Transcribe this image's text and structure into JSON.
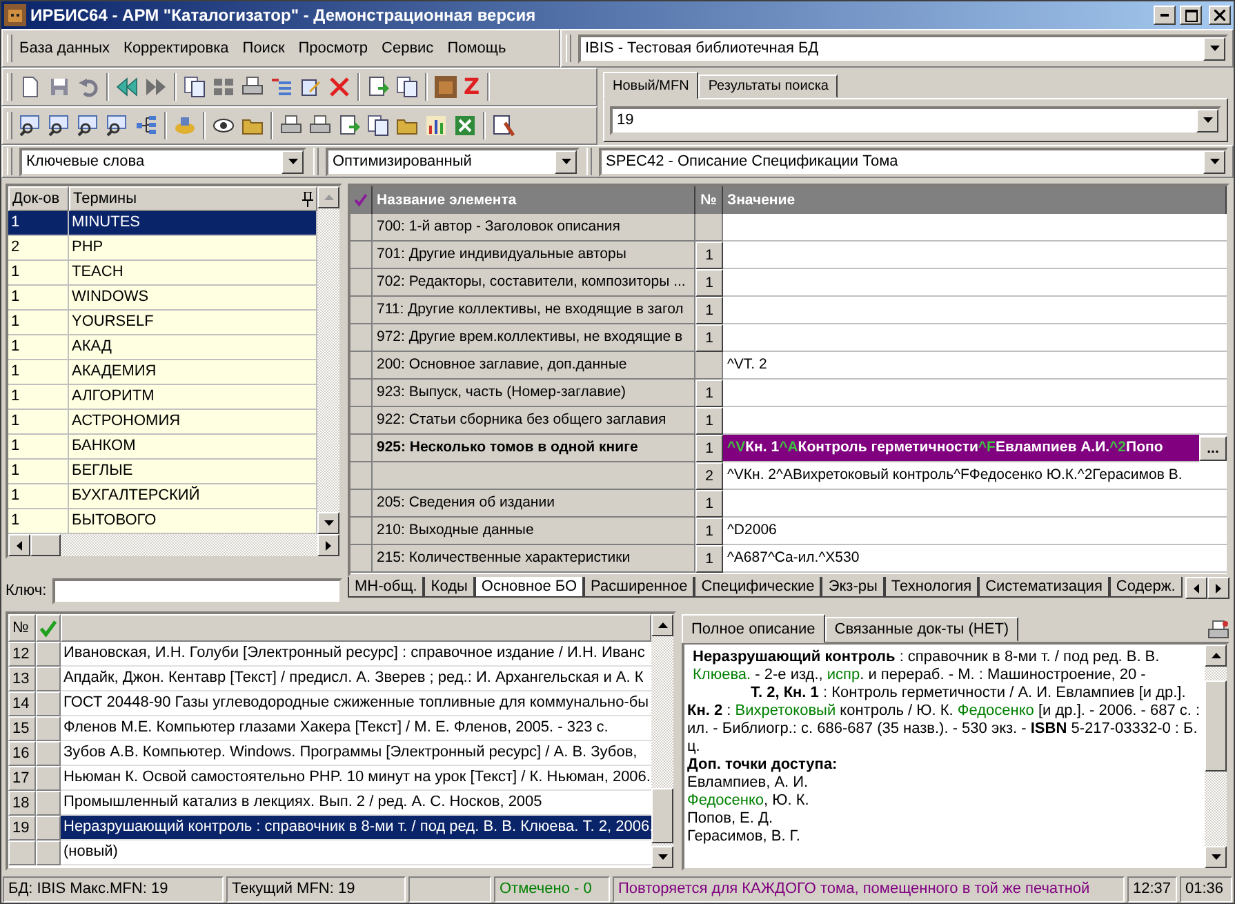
{
  "window": {
    "title": "ИРБИС64 - АРМ \"Каталогизатор\" - Демонстрационная версия"
  },
  "menu": [
    "База данных",
    "Корректировка",
    "Поиск",
    "Просмотр",
    "Сервис",
    "Помощь"
  ],
  "toolbar": {
    "z_button": "Z"
  },
  "database_combo": {
    "value": "IBIS - Тестовая библиотечная БД"
  },
  "search_tabs": [
    {
      "label": "Новый/MFN",
      "selected": true
    },
    {
      "label": "Результаты поиска",
      "selected": false
    }
  ],
  "mfn_combo": {
    "value": "19"
  },
  "dictionary_combo": {
    "value": "Ключевые слова"
  },
  "mode_combo": {
    "value": "Оптимизированный"
  },
  "worksheet_combo": {
    "value": "SPEC42 - Описание Спецификации Тома"
  },
  "terms": {
    "columns": [
      "Док-ов",
      "Термины"
    ],
    "rows": [
      {
        "count": "1",
        "term": "MINUTES",
        "selected": true
      },
      {
        "count": "2",
        "term": "PHP",
        "selected": false
      },
      {
        "count": "1",
        "term": "TEACH",
        "selected": false
      },
      {
        "count": "1",
        "term": "WINDOWS",
        "selected": false
      },
      {
        "count": "1",
        "term": "YOURSELF",
        "selected": false
      },
      {
        "count": "1",
        "term": "АКАД",
        "selected": false
      },
      {
        "count": "1",
        "term": "АКАДЕМИЯ",
        "selected": false
      },
      {
        "count": "1",
        "term": "АЛГОРИТМ",
        "selected": false
      },
      {
        "count": "1",
        "term": "АСТРОНОМИЯ",
        "selected": false
      },
      {
        "count": "1",
        "term": "БАНКОМ",
        "selected": false
      },
      {
        "count": "1",
        "term": "БЕГЛЫЕ",
        "selected": false
      },
      {
        "count": "1",
        "term": "БУХГАЛТЕРСКИЙ",
        "selected": false
      },
      {
        "count": "1",
        "term": "БЫТОВОГО",
        "selected": false
      }
    ]
  },
  "key_field": {
    "label": "Ключ:"
  },
  "fields_grid": {
    "columns": [
      "Название элемента",
      "№",
      "Значение"
    ],
    "rows": [
      {
        "name": "700: 1-й автор - Заголовок описания",
        "bold": false,
        "selected": false
      },
      {
        "name": "701: Другие индивидуальные авторы",
        "occurrence": "1",
        "bold": false,
        "selected": false
      },
      {
        "name": "702: Редакторы, составители, композиторы ...",
        "occurrence": "1",
        "bold": false,
        "selected": false
      },
      {
        "name": "711: Другие коллективы, не входящие в загол",
        "occurrence": "1",
        "bold": false,
        "selected": false
      },
      {
        "name": "972: Другие врем.коллективы, не входящие в",
        "occurrence": "1",
        "bold": false,
        "selected": false
      },
      {
        "name": "200: Основное заглавие, доп.данные",
        "value": "^VТ. 2",
        "bold": false,
        "selected": false
      },
      {
        "name": "923: Выпуск, часть (Номер-заглавие)",
        "occurrence": "1",
        "bold": false,
        "selected": false
      },
      {
        "name": "922: Статьи сборника без общего заглавия",
        "occurrence": "1",
        "bold": false,
        "selected": false
      },
      {
        "name": "925: Несколько томов в одной книге",
        "occurrence": "1",
        "bold": true,
        "selected": true,
        "button": "...",
        "value_runs": [
          {
            "kind": "subfield",
            "text": "^V"
          },
          {
            "kind": "text",
            "text": "Кн. 1"
          },
          {
            "kind": "subfield",
            "text": "^A"
          },
          {
            "kind": "text",
            "text": "Контроль герметичности"
          },
          {
            "kind": "subfield",
            "text": "^F"
          },
          {
            "kind": "text",
            "text": "Евлампиев А.И."
          },
          {
            "kind": "subfield",
            "text": "^2"
          },
          {
            "kind": "text",
            "text": "Попо"
          }
        ]
      },
      {
        "occurrence": "2",
        "value": "^VКн. 2^AВихретоковый контроль^FФедосенко Ю.К.^2Герасимов В.",
        "selected": false
      },
      {
        "name": "205: Сведения об издании",
        "occurrence": "1",
        "bold": false,
        "selected": false
      },
      {
        "name": "210: Выходные данные",
        "occurrence": "1",
        "value": "^D2006",
        "bold": false,
        "selected": false
      },
      {
        "name": "215: Количественные характеристики",
        "occurrence": "1",
        "value": "^A687^Cа-ил.^X530",
        "bold": false,
        "selected": false
      }
    ]
  },
  "worksheet_tabs": [
    {
      "label": "МН-общ.",
      "selected": false
    },
    {
      "label": "Коды",
      "selected": false
    },
    {
      "label": "Основное БО",
      "selected": true
    },
    {
      "label": "Расширенное",
      "selected": false
    },
    {
      "label": "Специфические",
      "selected": false
    },
    {
      "label": "Экз-ры",
      "selected": false
    },
    {
      "label": "Технология",
      "selected": false
    },
    {
      "label": "Систематизация",
      "selected": false
    },
    {
      "label": "Содерж.",
      "selected": false
    }
  ],
  "records": {
    "columns": [
      "№"
    ],
    "rows": [
      {
        "num": "12",
        "text": "Ивановская, И.Н. Голуби [Электронный ресурс] : справочное издание / И.Н. Иванс",
        "selected": false
      },
      {
        "num": "13",
        "text": "Апдайк, Джон. Кентавр [Текст] / предисл. А. Зверев ; ред.: И. Архангельская и А. К",
        "selected": false
      },
      {
        "num": "14",
        "text": "ГОСТ 20448-90 Газы углеводородные сжиженные топливные для коммунально-бы",
        "selected": false
      },
      {
        "num": "15",
        "text": "Фленов М.Е. Компьютер глазами Хакера [Текст] / М. Е. Фленов, 2005. - 323 с.",
        "selected": false
      },
      {
        "num": "16",
        "text": "Зубов А.В. Компьютер. Windows. Программы [Электронный ресурс] / А. В. Зубов,",
        "selected": false
      },
      {
        "num": "17",
        "text": "Ньюман К. Освой самостоятельно PHP. 10 минут на урок [Текст] / К. Ньюман, 2006.",
        "selected": false
      },
      {
        "num": "18",
        "text": "Промышленный катализ в лекциях. Вып. 2 / ред. А. С. Носков, 2005",
        "selected": false
      },
      {
        "num": "19",
        "text": "Неразрушающий контроль : справочник в 8-ми т. / под ред. В. В. Клюева. Т. 2, 2006.",
        "selected": true
      },
      {
        "text": "(новый)",
        "selected": false
      }
    ]
  },
  "description_tabs": [
    {
      "label": "Полное описание",
      "selected": true
    },
    {
      "label": "Связанные док-ты (НЕТ)",
      "selected": false
    }
  ],
  "description": {
    "paragraphs": [
      {
        "kind": "body",
        "runs": [
          {
            "kind": "bold",
            "text": "Неразрушающий контроль"
          },
          {
            "kind": "text",
            "text": " : справочник в 8-ми т. / под ред. В. В. "
          },
          {
            "kind": "link",
            "text": "Клюева."
          },
          {
            "kind": "text",
            "text": " - 2-е изд., "
          },
          {
            "kind": "link",
            "text": "испр"
          },
          {
            "kind": "text",
            "text": ". и перераб. - М. : Машиностроение, 20 -"
          }
        ]
      },
      {
        "kind": "indented",
        "runs": [
          {
            "kind": "bold",
            "text": "Т. 2, Кн. 1"
          },
          {
            "kind": "text",
            "text": " : Контроль герметичности / А. И. Евлампиев [и др.]. "
          },
          {
            "kind": "bold",
            "text": "Кн. 2"
          },
          {
            "kind": "text",
            "text": " : "
          },
          {
            "kind": "link",
            "text": "Вихретоковый"
          },
          {
            "kind": "text",
            "text": " контроль / Ю. К. "
          },
          {
            "kind": "link",
            "text": "Федосенко"
          },
          {
            "kind": "text",
            "text": " [и др.]. - 2006. - 687 с. : ил. - Библиогр.: с. 686-687 (35 назв.). - 530 экз. - "
          },
          {
            "kind": "bold",
            "text": "ISBN"
          },
          {
            "kind": "text",
            "text": " 5-217-03332-0 : Б. ц."
          }
        ]
      },
      {
        "kind": "heading",
        "runs": [
          {
            "kind": "text",
            "text": "Доп. точки доступа:"
          }
        ]
      },
      {
        "kind": "entry",
        "runs": [
          {
            "kind": "text",
            "text": "Евлампиев, А. И."
          }
        ]
      },
      {
        "kind": "entry",
        "runs": [
          {
            "kind": "link",
            "text": "Федосенко"
          },
          {
            "kind": "text",
            "text": ", Ю. К."
          }
        ]
      },
      {
        "kind": "entry",
        "runs": [
          {
            "kind": "text",
            "text": "Попов, Е. Д."
          }
        ]
      },
      {
        "kind": "entry",
        "runs": [
          {
            "kind": "text",
            "text": "Герасимов, В. Г."
          }
        ]
      }
    ]
  },
  "status_bar": [
    {
      "text": "БД: IBIS Макс.MFN: 19",
      "color": "#000000"
    },
    {
      "text": "Текущий MFN: 19",
      "color": "#000000"
    },
    {
      "text": "Отмечено - 0",
      "color": "#008000"
    },
    {
      "text": "Повторяется для КАЖДОГО тома, помещенного в той же печатной",
      "color": "#800080"
    },
    {
      "text": "12:37",
      "color": "#000000"
    },
    {
      "text": "01:36",
      "color": "#000000"
    }
  ]
}
